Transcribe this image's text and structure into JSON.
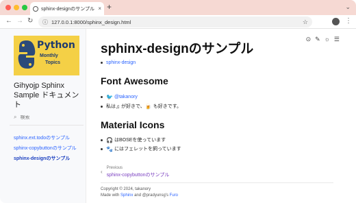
{
  "browser": {
    "tab_title": "sphinx-designのサンプル - Gi...",
    "tab_close": "×",
    "new_tab": "+",
    "url": "127.0.0.1:8000/sphinx_design.html"
  },
  "sidebar": {
    "logo": {
      "line1": "Python",
      "line2": "Monthly",
      "line3": "Topics"
    },
    "site_title": "Gihyojp Sphinx Sample ドキュメント",
    "search_placeholder": "検索",
    "items": [
      {
        "label": "sphinx.ext.todoのサンプル",
        "active": false
      },
      {
        "label": "sphinx-copybuttonのサンプル",
        "active": false
      },
      {
        "label": "sphinx-designのサンプル",
        "active": true
      }
    ]
  },
  "main": {
    "title": "sphinx-designのサンプル",
    "toc_link": "sphinx-design",
    "sections": {
      "font_awesome": {
        "heading": "Font Awesome",
        "twitter_handle": "@takanory",
        "music_text_before": "私は",
        "music_text_middle": "が好きで、",
        "music_text_after": "も好きです。"
      },
      "material_icons": {
        "heading": "Material Icons",
        "item1": "はBOSEを使っています",
        "item2": "にはフェレットを飼っています"
      }
    },
    "prev": {
      "label": "Previous",
      "title": "sphinx-copybuttonのサンプル"
    },
    "footer": {
      "copyright": "Copyright © 2024, takanory",
      "made_with": "Made with",
      "sphinx": "Sphinx",
      "and": "and @pradyunsg's",
      "furo": "Furo"
    }
  },
  "colors": {
    "accent": "#2962ff",
    "visited": "#7a3fc0",
    "tabstrip": "#f6d9d3",
    "logo_bg": "#f4d046"
  }
}
